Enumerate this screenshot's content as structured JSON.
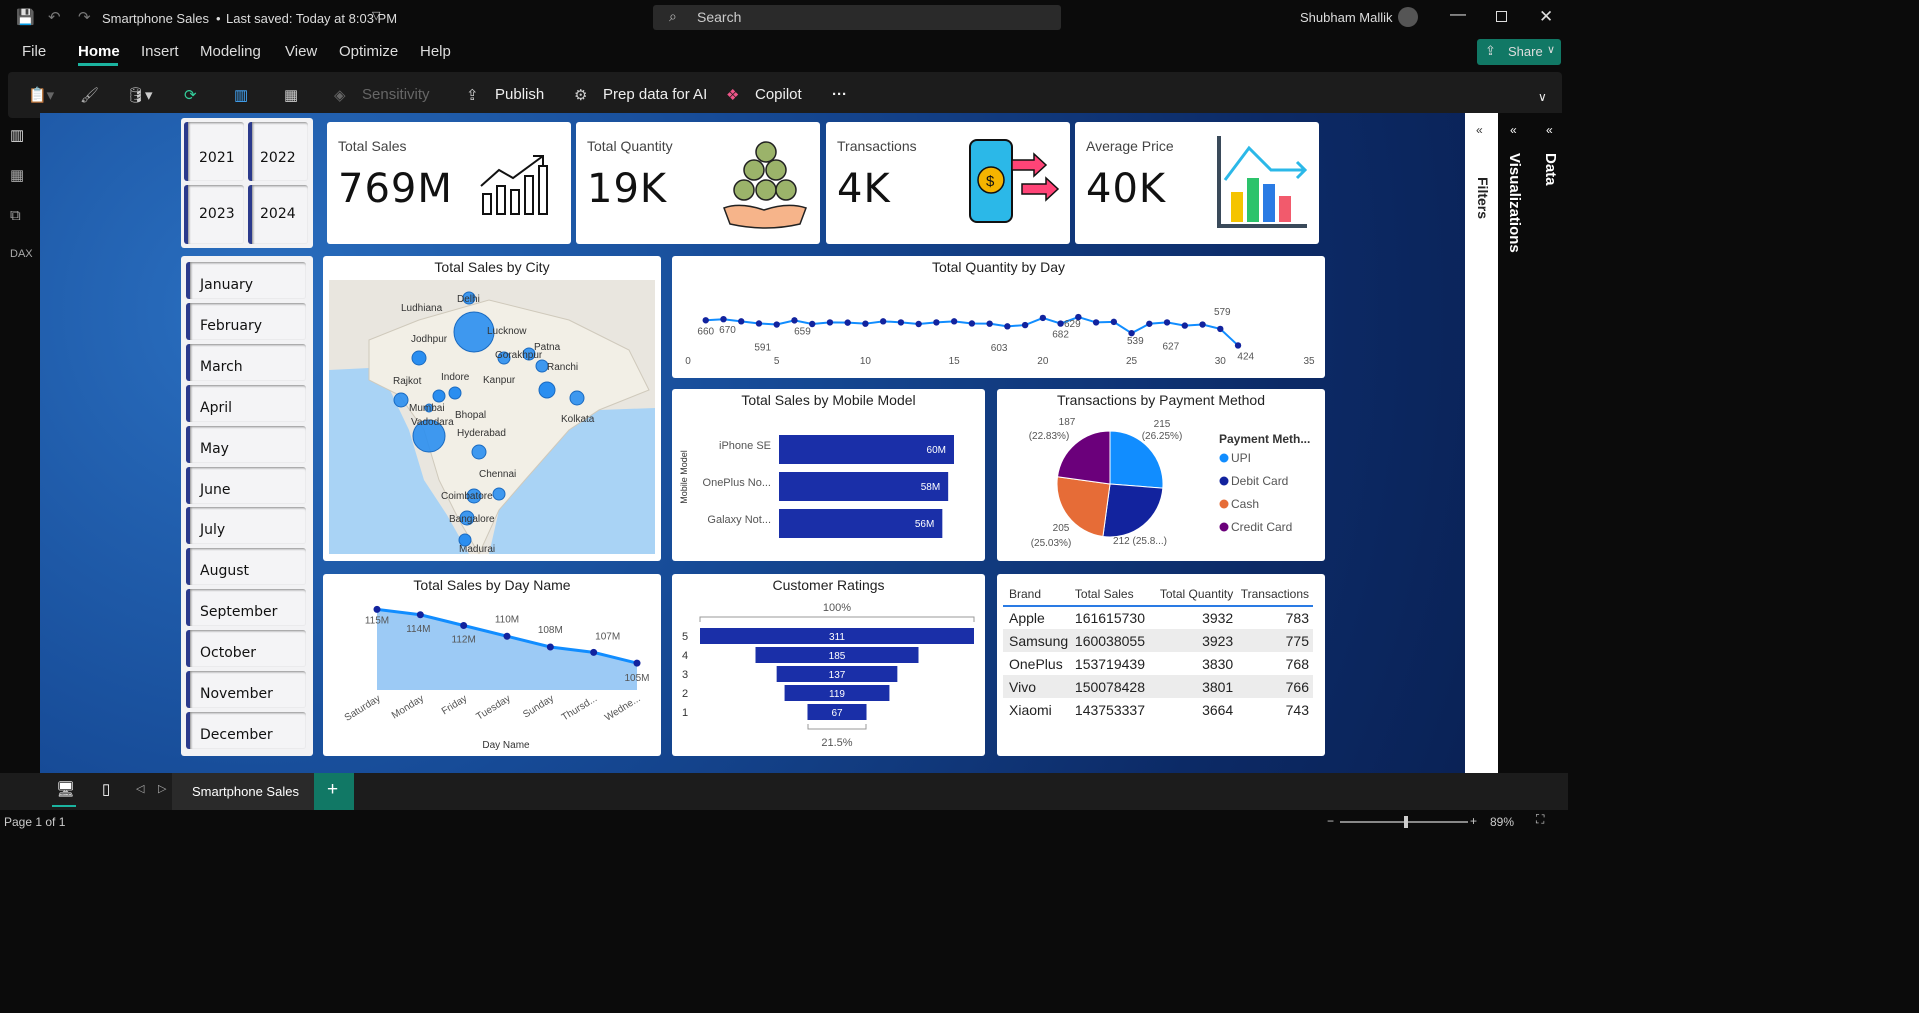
{
  "titlebar": {
    "title": "Smartphone Sales",
    "saved": "Last saved: Today at 8:03 PM",
    "search": "Search",
    "user": "Shubham Mallik"
  },
  "menu": {
    "file": "File",
    "home": "Home",
    "insert": "Insert",
    "modeling": "Modeling",
    "view": "View",
    "optimize": "Optimize",
    "help": "Help",
    "share": "Share"
  },
  "ribbon": {
    "sensitivity": "Sensitivity",
    "publish": "Publish",
    "prep": "Prep data for AI",
    "copilot": "Copilot",
    "more": "···"
  },
  "years": [
    "2021",
    "2022",
    "2023",
    "2024"
  ],
  "months": [
    "January",
    "February",
    "March",
    "April",
    "May",
    "June",
    "July",
    "August",
    "September",
    "October",
    "November",
    "December"
  ],
  "kpis": [
    {
      "title": "Total Sales",
      "value": "769M"
    },
    {
      "title": "Total Quantity",
      "value": "19K"
    },
    {
      "title": "Transactions",
      "value": "4K"
    },
    {
      "title": "Average Price",
      "value": "40K"
    }
  ],
  "map": {
    "title": "Total Sales by City",
    "cities": [
      "Delhi",
      "Ludhiana",
      "Lucknow",
      "Jodhpur",
      "Gorakhpur",
      "Patna",
      "Ranchi",
      "Indore",
      "Kanpur",
      "Rajkot",
      "Mumbai",
      "Bhopal",
      "Vadodara",
      "Hyderabad",
      "Kolkata",
      "Chennai",
      "Coimbatore",
      "Bangalore",
      "Madurai"
    ]
  },
  "day_chart": {
    "title": "Total Quantity by Day",
    "x_ticks": [
      "0",
      "5",
      "10",
      "15",
      "20",
      "25",
      "30",
      "35"
    ],
    "labels": [
      "660",
      "670",
      "659",
      "591",
      "603",
      "682",
      "629",
      "539",
      "627",
      "579",
      "424"
    ]
  },
  "model_chart": {
    "title": "Total Sales by Mobile Model",
    "ylabel": "Mobile Model"
  },
  "payment_chart": {
    "title": "Transactions by Payment Method",
    "legend_title": "Payment Meth...",
    "labels": [
      "215",
      "(26.25%)",
      "212 (25.8...)",
      "205",
      "(25.03%)",
      "187",
      "(22.83%)"
    ]
  },
  "dayname_chart": {
    "title": "Total Sales by Day Name",
    "xlabel": "Day Name"
  },
  "ratings": {
    "title": "Customer Ratings",
    "top": "100%",
    "bottom": "21.5%"
  },
  "table": {
    "headers": [
      "Brand",
      "Total Sales",
      "Total Quantity",
      "Transactions"
    ],
    "rows": [
      [
        "Apple",
        "161615730",
        "3932",
        "783"
      ],
      [
        "Samsung",
        "160038055",
        "3923",
        "775"
      ],
      [
        "OnePlus",
        "153719439",
        "3830",
        "768"
      ],
      [
        "Vivo",
        "150078428",
        "3801",
        "766"
      ],
      [
        "Xiaomi",
        "143753337",
        "3664",
        "743"
      ]
    ]
  },
  "panes": {
    "filters": "Filters",
    "visualizations": "Visualizations",
    "data": "Data"
  },
  "tabs": {
    "page": "Smartphone Sales",
    "add": "+"
  },
  "status": {
    "page": "Page 1 of 1",
    "zoom": "89%"
  },
  "chart_data": [
    {
      "type": "line",
      "title": "Total Quantity by Day",
      "x": [
        1,
        2,
        3,
        4,
        5,
        6,
        7,
        8,
        9,
        10,
        11,
        12,
        13,
        14,
        15,
        16,
        17,
        18,
        19,
        20,
        21,
        22,
        23,
        24,
        25,
        26,
        27,
        28,
        29,
        30,
        31
      ],
      "values": [
        660,
        670,
        650,
        630,
        620,
        659,
        625,
        640,
        638,
        628,
        650,
        640,
        625,
        640,
        650,
        630,
        628,
        603,
        615,
        682,
        629,
        690,
        640,
        645,
        539,
        627,
        640,
        610,
        620,
        579,
        424
      ],
      "xlim": [
        0,
        35
      ]
    },
    {
      "type": "bar",
      "title": "Total Sales by Mobile Model",
      "categories": [
        "iPhone SE",
        "OnePlus No...",
        "Galaxy Not..."
      ],
      "values": [
        60,
        58,
        56
      ],
      "value_labels": [
        "60M",
        "58M",
        "56M"
      ]
    },
    {
      "type": "pie",
      "title": "Transactions by Payment Method",
      "categories": [
        "UPI",
        "Debit Card",
        "Cash",
        "Credit Card"
      ],
      "values": [
        215,
        212,
        205,
        187
      ],
      "colors": [
        "#118dff",
        "#12239e",
        "#e66c37",
        "#6b007b"
      ]
    },
    {
      "type": "area",
      "title": "Total Sales by Day Name",
      "categories": [
        "Saturday",
        "Monday",
        "Friday",
        "Tuesday",
        "Sunday",
        "Thursd...",
        "Wedne..."
      ],
      "values": [
        115,
        114,
        112,
        110,
        108,
        107,
        105
      ],
      "value_labels": [
        "115M",
        "114M",
        "112M",
        "110M",
        "108M",
        "107M",
        "105M"
      ]
    },
    {
      "type": "bar",
      "title": "Customer Ratings",
      "categories": [
        "5",
        "4",
        "3",
        "2",
        "1"
      ],
      "values": [
        311,
        185,
        137,
        119,
        67
      ]
    }
  ]
}
